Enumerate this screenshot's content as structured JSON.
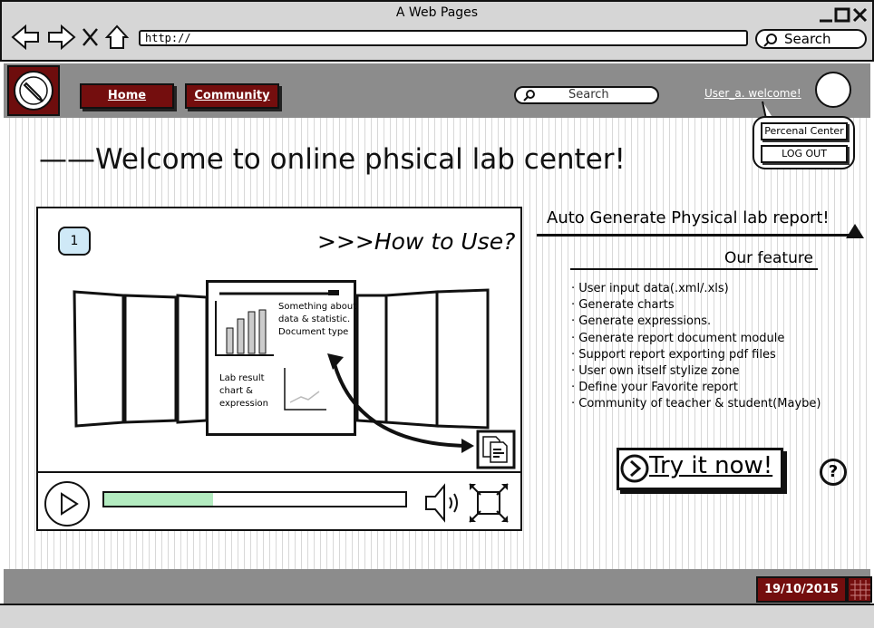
{
  "window": {
    "title": "A Web Pages"
  },
  "browser": {
    "url": "http://",
    "search_label": "Search"
  },
  "header": {
    "nav": [
      {
        "label": "Home"
      },
      {
        "label": "Community"
      }
    ],
    "search_placeholder": "Search",
    "user_welcome": "User_a. welcome!"
  },
  "user_menu": {
    "personal": "Percenal Center",
    "logout": "LOG OUT"
  },
  "welcome": "——Welcome to online phsical lab center!",
  "video": {
    "badge": "1",
    "title": ">>>How to Use?",
    "slide_text_top": [
      "Something about",
      "data & statistic.",
      "Document type"
    ],
    "slide_text_bottom": [
      "Lab result",
      "chart &",
      "expression"
    ],
    "progress": 0.36
  },
  "right_panel": {
    "title": "Auto Generate Physical lab report!",
    "feature_heading": "Our feature",
    "features": [
      "· User input data(.xml/.xls)",
      "· Generate charts",
      "· Generate expressions.",
      "· Generate report document module",
      "· Support report exporting pdf files",
      "· User own itself stylize zone",
      "· Define your Favorite report",
      "· Community of teacher & student(Maybe)"
    ],
    "try_button": "Try it now!",
    "help": "?"
  },
  "footer": {
    "date": "19/10/2015"
  },
  "colors": {
    "accent": "#740e0e",
    "header_bg": "#8c8c8c",
    "chrome_bg": "#d6d6d6",
    "progress_fill": "#b3ebc0"
  }
}
